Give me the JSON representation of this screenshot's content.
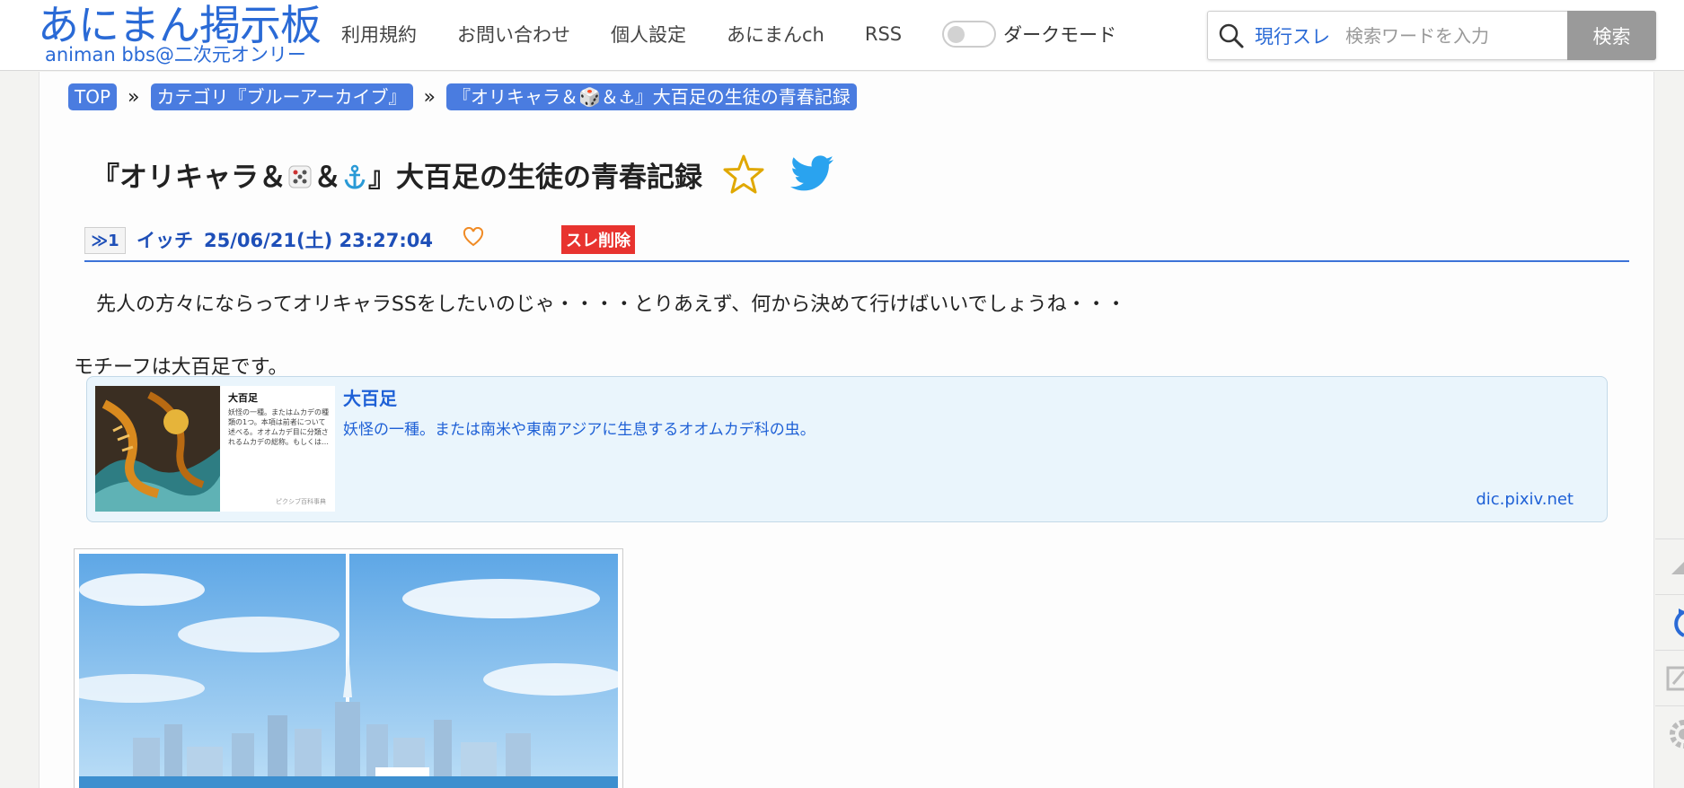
{
  "site": {
    "logo_main": "あにまん掲示板",
    "logo_sub": "animan bbs@二次元オンリー"
  },
  "nav": {
    "items": [
      "利用規約",
      "お問い合わせ",
      "個人設定",
      "あにまんch",
      "RSS"
    ],
    "dark_mode_label": "ダークモード",
    "dark_mode_on": false
  },
  "search": {
    "scope": "現行スレ",
    "placeholder": "検索ワードを入力",
    "button": "検索"
  },
  "breadcrumb": {
    "top": "TOP",
    "category": "カテゴリ『ブルーアーカイブ』",
    "thread": "『オリキャラ＆🎲＆⚓』大百足の生徒の青春記録",
    "separator": "»"
  },
  "thread": {
    "title_part1": "『オリキャラ＆",
    "title_part2": "＆",
    "title_part3": "』大百足の生徒の青春記録"
  },
  "post": {
    "number": "≫1",
    "name": "イッチ",
    "date": "25/06/21(土) 23:27:04",
    "delete_label": "スレ削除",
    "line1": "先人の方々にならってオリキャラSSをしたいのじゃ・・・・とりあえず、何から決めて行けばいいでしょうね・・・",
    "line2": "モチーフは大百足です。"
  },
  "link_card": {
    "title": "大百足",
    "description": "妖怪の一種。または南米や東南アジアに生息するオオムカデ科の虫。",
    "domain": "dic.pixiv.net",
    "thumb_title": "大百足",
    "thumb_text": "妖怪の一種。またはムカデの種類の1つ。本項は前者について述べる。オオムカデ目に分類されるムカデの総称。もしくは…",
    "thumb_source": "ピクシブ百科事典"
  },
  "colors": {
    "brand": "#2a6ad6",
    "crumb_bg": "#4a7ce0",
    "delete_bg": "#e8332f",
    "card_bg": "#eaf5fc"
  }
}
